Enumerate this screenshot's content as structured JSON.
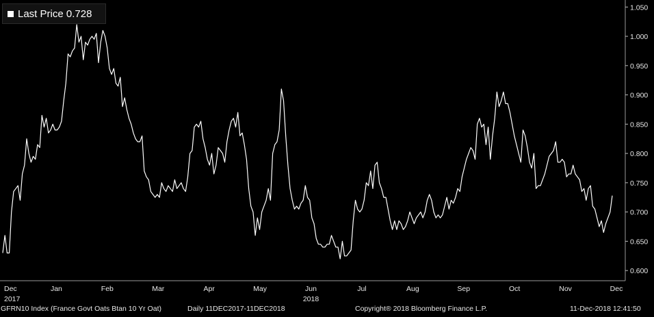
{
  "legend": {
    "label": "Last Price",
    "value": "0.728",
    "swatch_color": "#ffffff"
  },
  "footer": {
    "security": "GFRN10 Index (France Govt Oats Btan 10 Yr Oat)",
    "range": "Daily 11DEC2017-11DEC2018",
    "copyright": "Copyright® 2018 Bloomberg Finance L.P.",
    "timestamp": "11-Dec-2018 12:41:50"
  },
  "colors": {
    "background": "#000000",
    "line": "#ffffff",
    "text": "#e8e8e8"
  },
  "chart_data": {
    "type": "line",
    "title": "",
    "xlabel": "",
    "ylabel": "",
    "ylim": [
      0.585,
      1.055
    ],
    "y_axis_position": "right",
    "yticks": [
      "0.600",
      "0.650",
      "0.700",
      "0.750",
      "0.800",
      "0.850",
      "0.900",
      "0.950",
      "1.000",
      "1.050"
    ],
    "xticks": [
      {
        "label": "Dec",
        "sub": "2017"
      },
      {
        "label": "Jan",
        "sub": ""
      },
      {
        "label": "Feb",
        "sub": ""
      },
      {
        "label": "Mar",
        "sub": ""
      },
      {
        "label": "Apr",
        "sub": ""
      },
      {
        "label": "May",
        "sub": ""
      },
      {
        "label": "Jun",
        "sub": "2018"
      },
      {
        "label": "Jul",
        "sub": ""
      },
      {
        "label": "Aug",
        "sub": ""
      },
      {
        "label": "Sep",
        "sub": ""
      },
      {
        "label": "Oct",
        "sub": ""
      },
      {
        "label": "Nov",
        "sub": ""
      },
      {
        "label": "Dec",
        "sub": ""
      }
    ],
    "grid": false,
    "legend_position": "top-left",
    "series": [
      {
        "name": "Last Price",
        "values": [
          0.63,
          0.66,
          0.63,
          0.63,
          0.7,
          0.735,
          0.74,
          0.745,
          0.72,
          0.765,
          0.78,
          0.825,
          0.8,
          0.785,
          0.795,
          0.79,
          0.815,
          0.81,
          0.865,
          0.845,
          0.86,
          0.835,
          0.84,
          0.85,
          0.84,
          0.84,
          0.845,
          0.855,
          0.89,
          0.92,
          0.97,
          0.965,
          0.975,
          0.98,
          1.02,
          0.99,
          1.0,
          0.96,
          0.99,
          0.985,
          0.995,
          1.0,
          0.995,
          1.005,
          0.955,
          0.99,
          1.01,
          1.0,
          0.98,
          0.945,
          0.935,
          0.945,
          0.92,
          0.915,
          0.93,
          0.88,
          0.895,
          0.875,
          0.86,
          0.85,
          0.835,
          0.825,
          0.82,
          0.82,
          0.83,
          0.77,
          0.76,
          0.755,
          0.735,
          0.73,
          0.725,
          0.73,
          0.725,
          0.75,
          0.74,
          0.735,
          0.745,
          0.74,
          0.735,
          0.755,
          0.74,
          0.745,
          0.75,
          0.74,
          0.735,
          0.76,
          0.8,
          0.805,
          0.845,
          0.85,
          0.845,
          0.855,
          0.825,
          0.81,
          0.79,
          0.78,
          0.8,
          0.765,
          0.78,
          0.81,
          0.805,
          0.8,
          0.785,
          0.82,
          0.84,
          0.855,
          0.86,
          0.845,
          0.87,
          0.83,
          0.835,
          0.815,
          0.79,
          0.74,
          0.71,
          0.7,
          0.66,
          0.69,
          0.67,
          0.7,
          0.71,
          0.72,
          0.74,
          0.72,
          0.8,
          0.815,
          0.82,
          0.84,
          0.91,
          0.89,
          0.83,
          0.78,
          0.74,
          0.72,
          0.705,
          0.71,
          0.705,
          0.715,
          0.72,
          0.745,
          0.725,
          0.72,
          0.69,
          0.68,
          0.655,
          0.645,
          0.645,
          0.64,
          0.64,
          0.645,
          0.645,
          0.66,
          0.65,
          0.64,
          0.64,
          0.62,
          0.65,
          0.625,
          0.625,
          0.63,
          0.635,
          0.685,
          0.72,
          0.705,
          0.7,
          0.705,
          0.72,
          0.75,
          0.745,
          0.77,
          0.74,
          0.78,
          0.785,
          0.75,
          0.74,
          0.725,
          0.725,
          0.705,
          0.685,
          0.67,
          0.685,
          0.67,
          0.685,
          0.68,
          0.67,
          0.675,
          0.685,
          0.7,
          0.69,
          0.68,
          0.69,
          0.695,
          0.7,
          0.69,
          0.7,
          0.72,
          0.73,
          0.72,
          0.7,
          0.69,
          0.695,
          0.69,
          0.695,
          0.71,
          0.725,
          0.705,
          0.72,
          0.715,
          0.725,
          0.74,
          0.735,
          0.76,
          0.775,
          0.79,
          0.8,
          0.81,
          0.805,
          0.79,
          0.85,
          0.86,
          0.845,
          0.85,
          0.815,
          0.845,
          0.79,
          0.83,
          0.86,
          0.905,
          0.88,
          0.89,
          0.905,
          0.885,
          0.885,
          0.87,
          0.85,
          0.83,
          0.815,
          0.8,
          0.785,
          0.84,
          0.83,
          0.81,
          0.785,
          0.775,
          0.8,
          0.74,
          0.745,
          0.745,
          0.755,
          0.765,
          0.78,
          0.795,
          0.8,
          0.805,
          0.82,
          0.785,
          0.785,
          0.79,
          0.785,
          0.76,
          0.765,
          0.765,
          0.78,
          0.765,
          0.76,
          0.755,
          0.735,
          0.74,
          0.72,
          0.74,
          0.745,
          0.71,
          0.705,
          0.69,
          0.675,
          0.685,
          0.665,
          0.68,
          0.69,
          0.7,
          0.728
        ]
      }
    ]
  }
}
